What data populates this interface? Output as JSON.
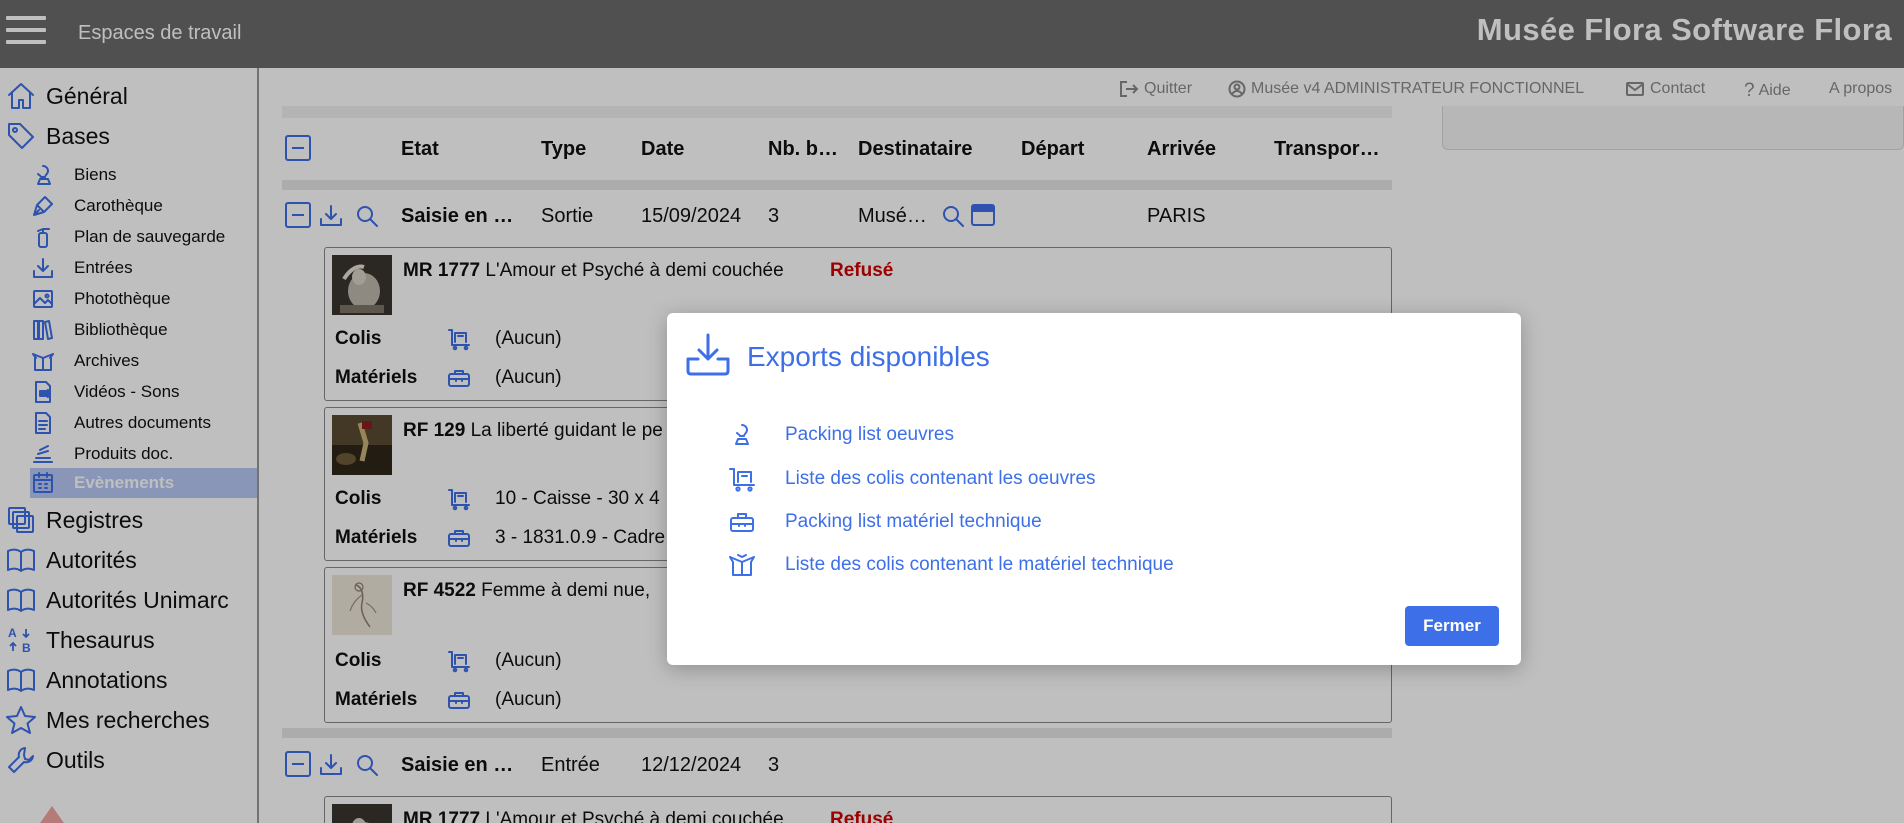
{
  "topbar": {
    "workspace_label": "Espaces de travail",
    "app_title": "Musée Flora Software Flora"
  },
  "sidebar": {
    "top_items": [
      {
        "label": "Général",
        "icon": "home-icon"
      },
      {
        "label": "Bases",
        "icon": "tag-icon"
      }
    ],
    "sub_items": [
      {
        "label": "Biens",
        "icon": "bust-icon"
      },
      {
        "label": "Carothèque",
        "icon": "pen-nib-icon"
      },
      {
        "label": "Plan de sauvegarde",
        "icon": "fire-extinguisher-icon"
      },
      {
        "label": "Entrées",
        "icon": "download-icon"
      },
      {
        "label": "Photothèque",
        "icon": "image-icon"
      },
      {
        "label": "Bibliothèque",
        "icon": "books-icon"
      },
      {
        "label": "Archives",
        "icon": "box-open-icon"
      },
      {
        "label": "Vidéos - Sons",
        "icon": "video-file-icon"
      },
      {
        "label": "Autres documents",
        "icon": "document-icon"
      },
      {
        "label": "Produits doc.",
        "icon": "stack-icon"
      },
      {
        "label": "Evènements",
        "icon": "calendar-icon",
        "active": true
      }
    ],
    "bottom_items": [
      {
        "label": "Registres",
        "icon": "registers-icon"
      },
      {
        "label": "Autorités",
        "icon": "book-open-icon"
      },
      {
        "label": "Autorités Unimarc",
        "icon": "book-open-icon"
      },
      {
        "label": "Thesaurus",
        "icon": "sort-az-icon"
      },
      {
        "label": "Annotations",
        "icon": "book-open-icon"
      },
      {
        "label": "Mes recherches",
        "icon": "star-icon"
      },
      {
        "label": "Outils",
        "icon": "wrench-icon"
      }
    ]
  },
  "header_links": {
    "quit": "Quitter",
    "user": "Musée v4 ADMINISTRATEUR FONCTIONNEL",
    "contact": "Contact",
    "help": "Aide",
    "about": "A propos"
  },
  "table": {
    "columns": [
      "Etat",
      "Type",
      "Date",
      "Nb. b…",
      "Destinataire",
      "Départ",
      "Arrivée",
      "Transpor…"
    ],
    "rows": [
      {
        "etat": "Saisie en …",
        "type": "Sortie",
        "date": "15/09/2024",
        "nb": "3",
        "destinataire": "Musé…",
        "arrivee": "PARIS"
      },
      {
        "etat": "Saisie en …",
        "type": "Entrée",
        "date": "12/12/2024",
        "nb": "3"
      }
    ],
    "cards": [
      {
        "ref": "MR 1777",
        "title": "L'Amour et Psyché à demi couchée",
        "status": "Refusé",
        "colis_label": "Colis",
        "colis_value": "(Aucun)",
        "materiels_label": "Matériels",
        "materiels_value": "(Aucun)"
      },
      {
        "ref": "RF 129",
        "title": "La liberté guidant le pe",
        "colis_label": "Colis",
        "colis_value": "10 - Caisse - 30 x 4",
        "materiels_label": "Matériels",
        "materiels_value": "3 - 1831.0.9 - Cadre"
      },
      {
        "ref": "RF 4522",
        "title": "Femme à demi nue,",
        "colis_label": "Colis",
        "colis_value": "(Aucun)",
        "materiels_label": "Matériels",
        "materiels_value": "(Aucun)"
      },
      {
        "ref": "MR 1777",
        "title": "L'Amour et Psyché à demi couchée",
        "status": "Refusé"
      }
    ]
  },
  "modal": {
    "title": "Exports disponibles",
    "items": [
      {
        "label": "Packing list oeuvres",
        "icon": "bust-icon"
      },
      {
        "label": "Liste des colis contenant les oeuvres",
        "icon": "cart-box-icon"
      },
      {
        "label": "Packing list matériel technique",
        "icon": "toolbox-icon"
      },
      {
        "label": "Liste des colis contenant le matériel technique",
        "icon": "box-open-icon"
      }
    ],
    "close_label": "Fermer"
  },
  "colors": {
    "accent": "#3d6fe8",
    "topbar": "#6b6b6b",
    "refused": "#d10000",
    "active_nav": "#b7c8f6"
  }
}
